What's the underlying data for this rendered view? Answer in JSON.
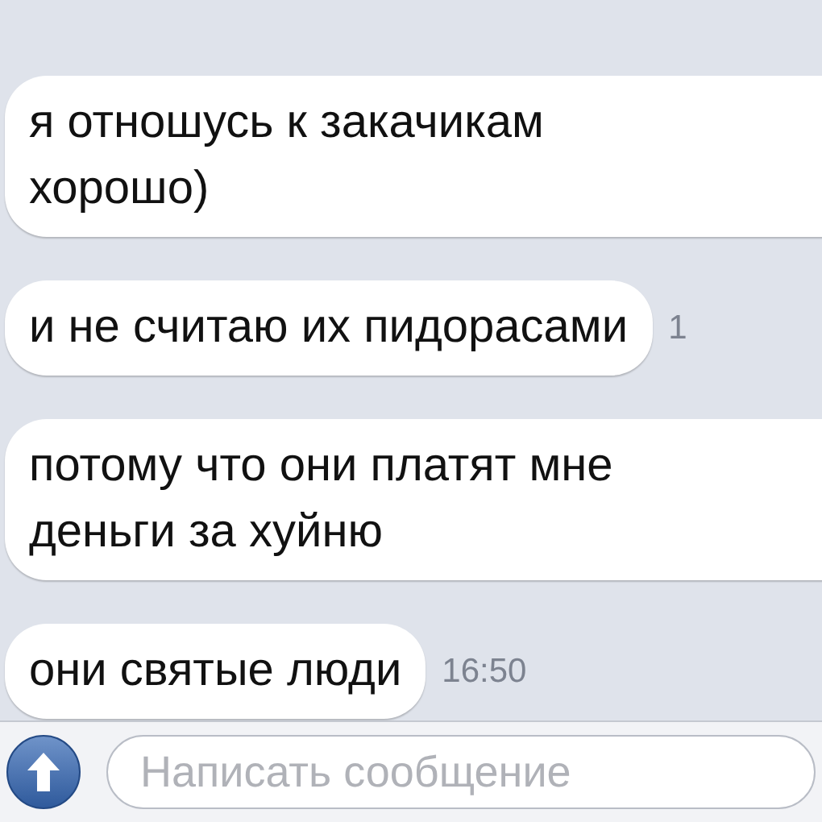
{
  "messages": [
    {
      "text": "я отношусь к закачикам хорошо)"
    },
    {
      "text": "и не считаю их пидорасами",
      "time": "1"
    },
    {
      "text": "потому что они платят мне деньги за хуйню"
    },
    {
      "text": "они святые люди",
      "time": "16:50"
    }
  ],
  "composer": {
    "placeholder": "Написать сообщение"
  }
}
